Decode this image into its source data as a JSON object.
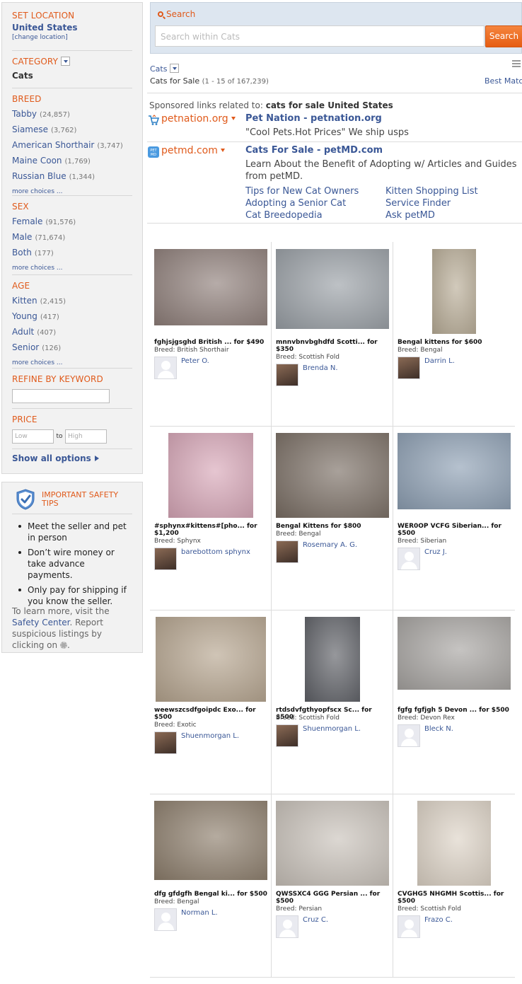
{
  "location": {
    "title": "SET LOCATION",
    "value": "United States",
    "change": "[change location]"
  },
  "category": {
    "title": "CATEGORY",
    "value": "Cats"
  },
  "breed": {
    "title": "BREED",
    "items": [
      {
        "label": "Tabby",
        "count": "(24,857)"
      },
      {
        "label": "Siamese",
        "count": "(3,762)"
      },
      {
        "label": "American Shorthair",
        "count": "(3,747)"
      },
      {
        "label": "Maine Coon",
        "count": "(1,769)"
      },
      {
        "label": "Russian Blue",
        "count": "(1,344)"
      }
    ],
    "more": "more choices ..."
  },
  "sex": {
    "title": "SEX",
    "items": [
      {
        "label": "Female",
        "count": "(91,576)"
      },
      {
        "label": "Male",
        "count": "(71,674)"
      },
      {
        "label": "Both",
        "count": "(177)"
      }
    ],
    "more": "more choices ..."
  },
  "age": {
    "title": "AGE",
    "items": [
      {
        "label": "Kitten",
        "count": "(2,415)"
      },
      {
        "label": "Young",
        "count": "(417)"
      },
      {
        "label": "Adult",
        "count": "(407)"
      },
      {
        "label": "Senior",
        "count": "(126)"
      }
    ],
    "more": "more choices ..."
  },
  "keyword": {
    "title": "REFINE BY KEYWORD",
    "value": ""
  },
  "price": {
    "title": "PRICE",
    "low_placeholder": "Low",
    "to": "to",
    "high_placeholder": "High"
  },
  "show_all": "Show all options",
  "safety": {
    "title": "IMPORTANT SAFETY TIPS",
    "tips": [
      "Meet the seller and pet in person",
      "Don’t wire money or take advance payments.",
      "Only pay for shipping if you know the seller."
    ],
    "foot_1": "To learn more, visit the ",
    "foot_link": "Safety Center",
    "foot_2": ". Report suspicious listings by clicking on ",
    "foot_3": "."
  },
  "search": {
    "label": "Search",
    "placeholder": "Search within Cats",
    "button": "Search"
  },
  "results": {
    "category": "Cats",
    "title": "Cats for Sale",
    "range": "(1 - 15 of 167,239)",
    "sort": "Best Match"
  },
  "sponsored": {
    "prefix": "Sponsored links related to: ",
    "query": "cats for sale United States"
  },
  "ads": [
    {
      "site": "petnation.org",
      "title": "Pet Nation - petnation.org",
      "desc": [
        "\"Cool Pets.Hot Prices\" We ship usps"
      ],
      "links": []
    },
    {
      "site": "petmd.com",
      "title": "Cats For Sale - petMD.com",
      "desc": [
        "Learn About the Benefit of Adopting w/ Articles and Guides",
        "from petMD."
      ],
      "links": [
        "Tips for New Cat Owners",
        "Kitten Shopping List",
        "Adopting a Senior Cat",
        "Service Finder",
        "Cat Breedopedia",
        "Ask petMD"
      ]
    }
  ],
  "listings": [
    {
      "title": "fghjsjgsghd British ... for $490",
      "breed": "Breed: British Shorthair",
      "seller": "Peter O.",
      "avatar": "default",
      "img_color": "#8f7f7a"
    },
    {
      "title": "mnnvbnvbghdfd Scotti... for $350",
      "breed": "Breed: Scottish Fold",
      "seller": "Brenda N.",
      "avatar": "photo",
      "img_color": "#9aa0a6"
    },
    {
      "title": "Bengal kittens for $600",
      "breed": "Breed: Bengal",
      "seller": "Darrin L.",
      "avatar": "photo",
      "img_color": "#b9ad97"
    },
    {
      "title": "#sphynx#kittens#[pho... for $1,200",
      "breed": "Breed: Sphynx",
      "seller": "barebottom sphynx",
      "avatar": "photo",
      "img_color": "#d8a7b8"
    },
    {
      "title": "Bengal Kittens for $800",
      "breed": "Breed: Bengal",
      "seller": "Rosemary A. G.",
      "avatar": "photo",
      "img_color": "#7a6e64"
    },
    {
      "title": "WER0OP VCFG Siberian... for $500",
      "breed": "Breed: Siberian",
      "seller": "Cruz J.",
      "avatar": "default",
      "img_color": "#8ea0b4"
    },
    {
      "title": "weewszcsdfgoipdc Exo... for $500",
      "breed": "Breed: Exotic",
      "seller": "Shuenmorgan L.",
      "avatar": "photo",
      "img_color": "#b6a58f"
    },
    {
      "title": "rtdsdvfgthyopfscx Sc... for $500",
      "breed": "Breed: Scottish Fold",
      "seller": "Shuenmorgan L.",
      "avatar": "photo",
      "img_color": "#5e6066"
    },
    {
      "title": "fgfg fgfjgh 5 Devon ... for $500",
      "breed": "Breed: Devon Rex",
      "seller": "Bleck N.",
      "avatar": "default",
      "img_color": "#a7a4a1"
    },
    {
      "title": "dfg gfdgfh Bengal ki... for $500",
      "breed": "Breed: Bengal",
      "seller": "Norman L.",
      "avatar": "default",
      "img_color": "#8d7e6c"
    },
    {
      "title": "QWSSXC4 GGG Persian ... for $500",
      "breed": "Breed: Persian",
      "seller": "Cruz C.",
      "avatar": "default",
      "img_color": "#c9c2ba"
    },
    {
      "title": "CVGHG5 NHGMH Scottis... for $500",
      "breed": "Breed: Scottish Fold",
      "seller": "Frazo C.",
      "avatar": "default",
      "img_color": "#ddd3c6"
    }
  ],
  "colors": {
    "accent": "#e05a1b",
    "link": "#3a5796",
    "button": "#f07a36"
  }
}
